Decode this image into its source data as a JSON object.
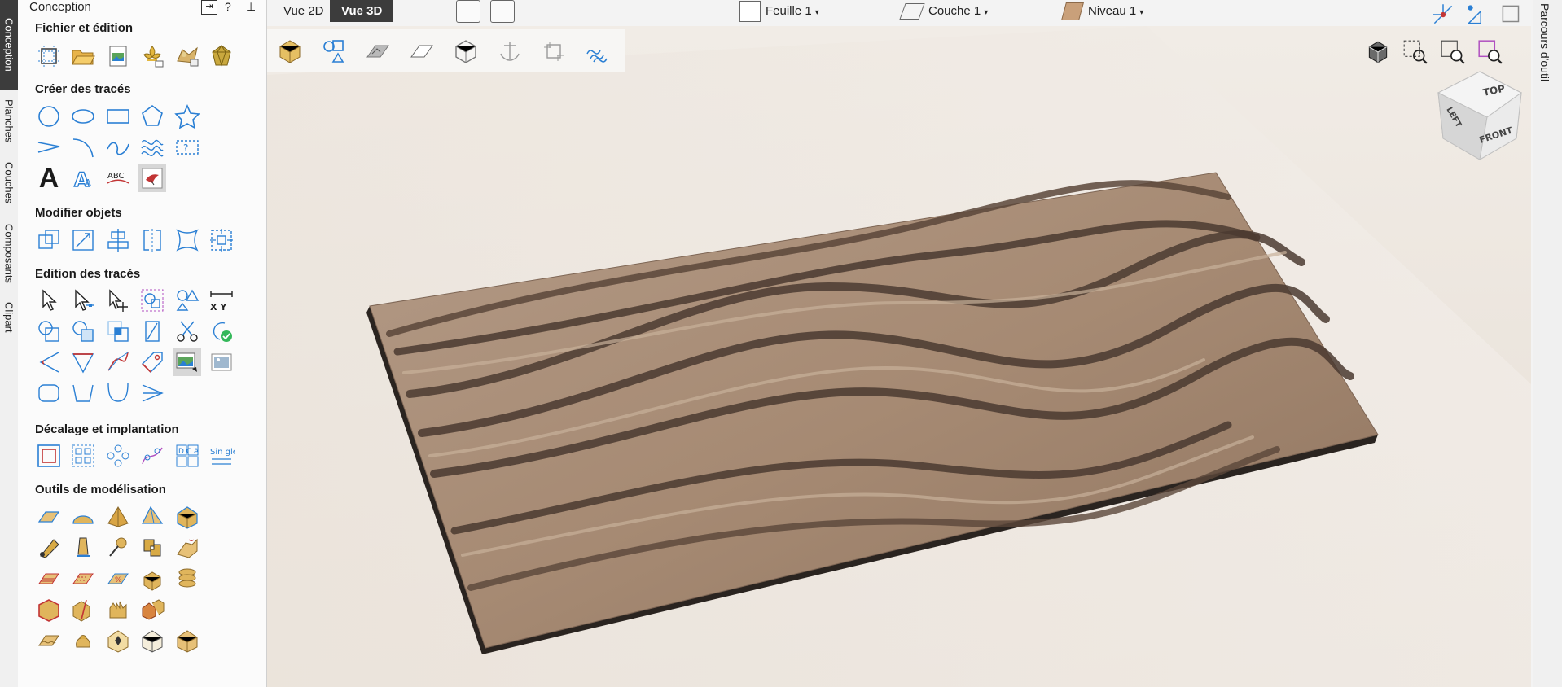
{
  "left_tabs": [
    {
      "label": "Conception",
      "active": true
    },
    {
      "label": "Planches",
      "active": false
    },
    {
      "label": "Couches",
      "active": false
    },
    {
      "label": "Composants",
      "active": false
    },
    {
      "label": "Clipart",
      "active": false
    }
  ],
  "panel": {
    "title": "Conception",
    "close_glyph": "⇥",
    "help_glyph": "?",
    "pin_glyph": "⊥",
    "sections": [
      {
        "title": "Fichier et édition"
      },
      {
        "title": "Créer des tracés"
      },
      {
        "title": "Modifier objets"
      },
      {
        "title": "Edition des tracés"
      },
      {
        "title": "Décalage et implantation"
      },
      {
        "title": "Outils de modélisation"
      }
    ],
    "xy_label": "X  Y",
    "abc_label": "ABC",
    "text_a": "A",
    "dc_label": "D C A B",
    "single_label": "Sin gle"
  },
  "topbar": {
    "vue2d": "Vue 2D",
    "vue3d": "Vue 3D",
    "sheet": "Feuille 1",
    "layer": "Couche 1",
    "level": "Niveau 1"
  },
  "viewcube": {
    "top": "TOP",
    "left": "LEFT",
    "front": "FRONT"
  },
  "right_tab": "Parcours d'outil",
  "colors": {
    "accent": "#2a7fd4",
    "wood": "#a88a73",
    "dark_tab": "#3c3c3c"
  }
}
